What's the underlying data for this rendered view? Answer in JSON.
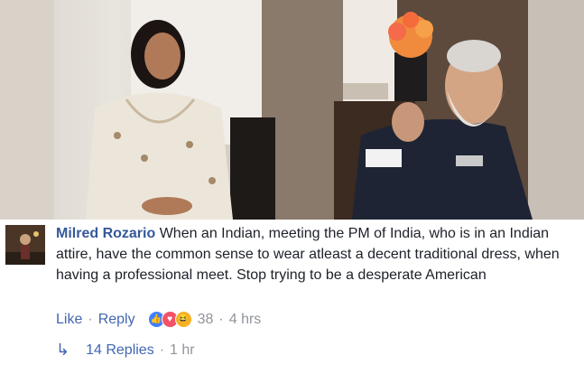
{
  "comment": {
    "author": "Milred Rozario",
    "text": "When an Indian, meeting the PM of India, who is in an Indian attire, have the common sense to wear atleast a decent traditional dress, when having a professional meet. Stop trying to be a desperate American",
    "like_label": "Like",
    "reply_label": "Reply",
    "reaction_count": "38",
    "timestamp": "4 hrs",
    "reactions": [
      "like-icon",
      "love-icon",
      "haha-icon"
    ],
    "replies_label": "14 Replies",
    "replies_time": "1 hr"
  },
  "colors": {
    "author": "#365899",
    "link": "#4267b2",
    "meta": "#90949c"
  }
}
